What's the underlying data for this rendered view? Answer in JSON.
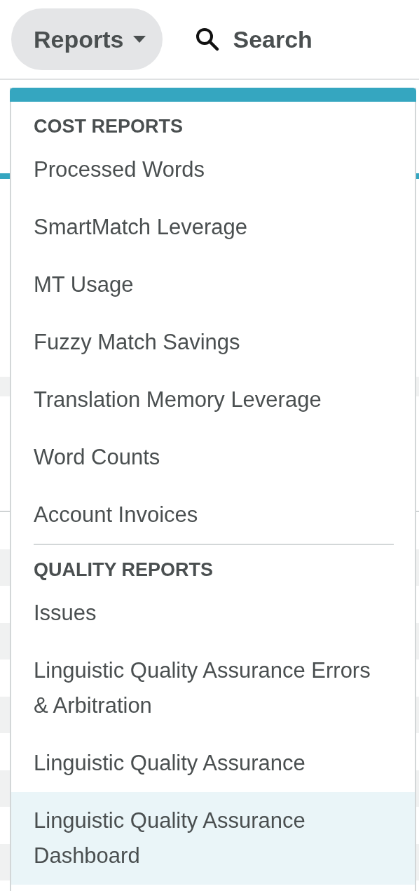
{
  "nav": {
    "reports_button": "Reports",
    "search_link": "Search"
  },
  "menu": {
    "sections": [
      {
        "heading": "COST REPORTS",
        "items": [
          {
            "label": "Processed Words",
            "selected": false
          },
          {
            "label": "SmartMatch Leverage",
            "selected": false
          },
          {
            "label": "MT Usage",
            "selected": false
          },
          {
            "label": "Fuzzy Match Savings",
            "selected": false
          },
          {
            "label": "Translation Memory Leverage",
            "selected": false
          },
          {
            "label": "Word Counts",
            "selected": false
          },
          {
            "label": "Account Invoices",
            "selected": false
          }
        ]
      },
      {
        "heading": "QUALITY REPORTS",
        "items": [
          {
            "label": "Issues",
            "selected": false
          },
          {
            "label": "Linguistic Quality Assurance Errors & Arbitration",
            "selected": false
          },
          {
            "label": "Linguistic Quality Assurance",
            "selected": false
          },
          {
            "label": "Linguistic Quality Assurance Dashboard",
            "selected": true
          }
        ]
      }
    ]
  }
}
